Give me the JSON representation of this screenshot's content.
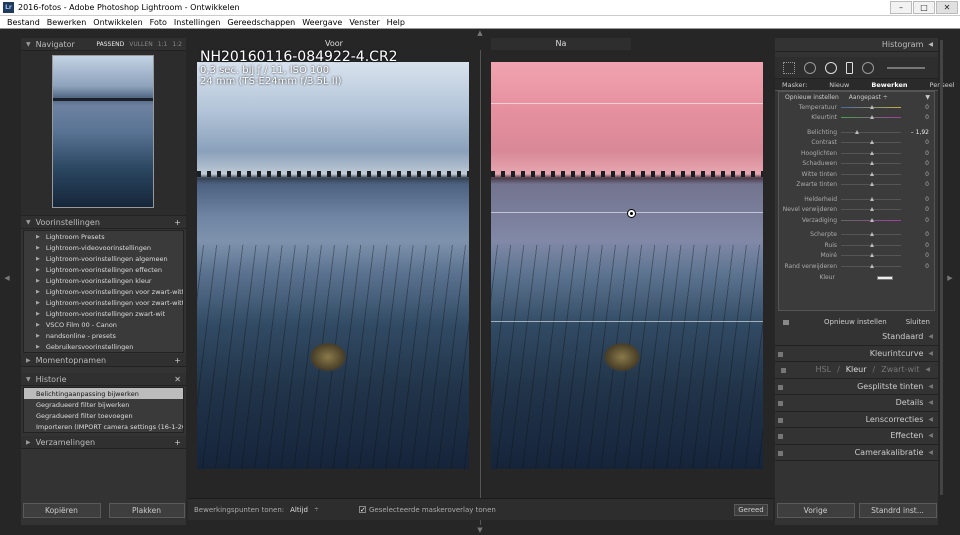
{
  "window": {
    "title": "2016-fotos - Adobe Photoshop Lightroom - Ontwikkelen",
    "app_icon": "Lr",
    "controls": [
      "–",
      "□",
      "✕"
    ]
  },
  "menu": [
    "Bestand",
    "Bewerken",
    "Ontwikkelen",
    "Foto",
    "Instellingen",
    "Gereedschappen",
    "Weergave",
    "Venster",
    "Help"
  ],
  "navigator": {
    "title": "Navigator",
    "options": [
      "PASSEND",
      "VULLEN",
      "1:1",
      "1:2"
    ]
  },
  "presets": {
    "title": "Voorinstellingen",
    "items": [
      "Lightroom Presets",
      "Lightroom-videovoorinstellingen",
      "Lightroom-voorinstellingen algemeen",
      "Lightroom-voorinstellingen effecten",
      "Lightroom-voorinstellingen kleur",
      "Lightroom-voorinstellingen voor zwart-witfilt...",
      "Lightroom-voorinstellingen voor zwart-witto...",
      "Lightroom-voorinstellingen zwart-wit",
      "VSCO Film 00 - Canon",
      "nandsonline - presets",
      "Gebruikersvoorinstellingen"
    ]
  },
  "snapshots": {
    "title": "Momentopnamen"
  },
  "history": {
    "title": "Historie",
    "items": [
      "Belichtingaanpassing bijwerken",
      "Gegradueerd filter bijwerken",
      "Gegradueerd filter toevoegen",
      "Importeren (IMPORT camera settings (16-1-201..."
    ],
    "selected": 0
  },
  "collections": {
    "title": "Verzamelingen"
  },
  "left_buttons": {
    "copy": "Kopiëren",
    "paste": "Plakken"
  },
  "view": {
    "before_label": "Voor",
    "after_label": "Na"
  },
  "file": {
    "name": "NH20160116-084922-4.CR2",
    "exposure": "0,3 sec. bij ƒ / 11, ISO 100",
    "lens": "24 mm (TS-E24mm f/3.5L II)"
  },
  "toolbar": {
    "show_points_label": "Bewerkingspunten tonen:",
    "show_points_value": "Altijd",
    "overlay_label": "Geselecteerde maskeroverlay tonen",
    "overlay_checked": "✓",
    "done": "Gereed"
  },
  "right": {
    "histogram": "Histogram",
    "mask_label": "Masker:",
    "mask_new": "Nieuw",
    "mask_edit": "Bewerken",
    "mask_brush": "Penseel",
    "reset_label": "Opnieuw instellen",
    "custom": "Aangepast ÷",
    "sliders": [
      {
        "label": "Temperatuur",
        "value": "0"
      },
      {
        "label": "Kleurtint",
        "value": "0"
      },
      {
        "label": "Belichting",
        "value": "– 1,92"
      },
      {
        "label": "Contrast",
        "value": "0"
      },
      {
        "label": "Hooglichten",
        "value": "0"
      },
      {
        "label": "Schaduwen",
        "value": "0"
      },
      {
        "label": "Witte tinten",
        "value": "0"
      },
      {
        "label": "Zwarte tinten",
        "value": "0"
      },
      {
        "label": "Helderheid",
        "value": "0"
      },
      {
        "label": "Nevel verwijderen",
        "value": "0"
      },
      {
        "label": "Verzadiging",
        "value": "0"
      },
      {
        "label": "Scherpte",
        "value": "0"
      },
      {
        "label": "Ruis",
        "value": "0"
      },
      {
        "label": "Moiré",
        "value": "0"
      },
      {
        "label": "Rand verwijderen",
        "value": "0"
      }
    ],
    "color_label": "Kleur",
    "reset_btn": "Opnieuw instellen",
    "close_btn": "Sluiten",
    "sections": [
      "Standaard",
      "Kleurintcurve",
      "Gesplitste tinten",
      "Details",
      "Lenscorrecties",
      "Effecten",
      "Camerakalibratie"
    ],
    "hsl": {
      "hsl": "HSL",
      "color": "Kleur",
      "bw": "Zwart-wit",
      "sep": "/"
    },
    "prev": "Vorige",
    "reset_default": "Standrd inst..."
  }
}
